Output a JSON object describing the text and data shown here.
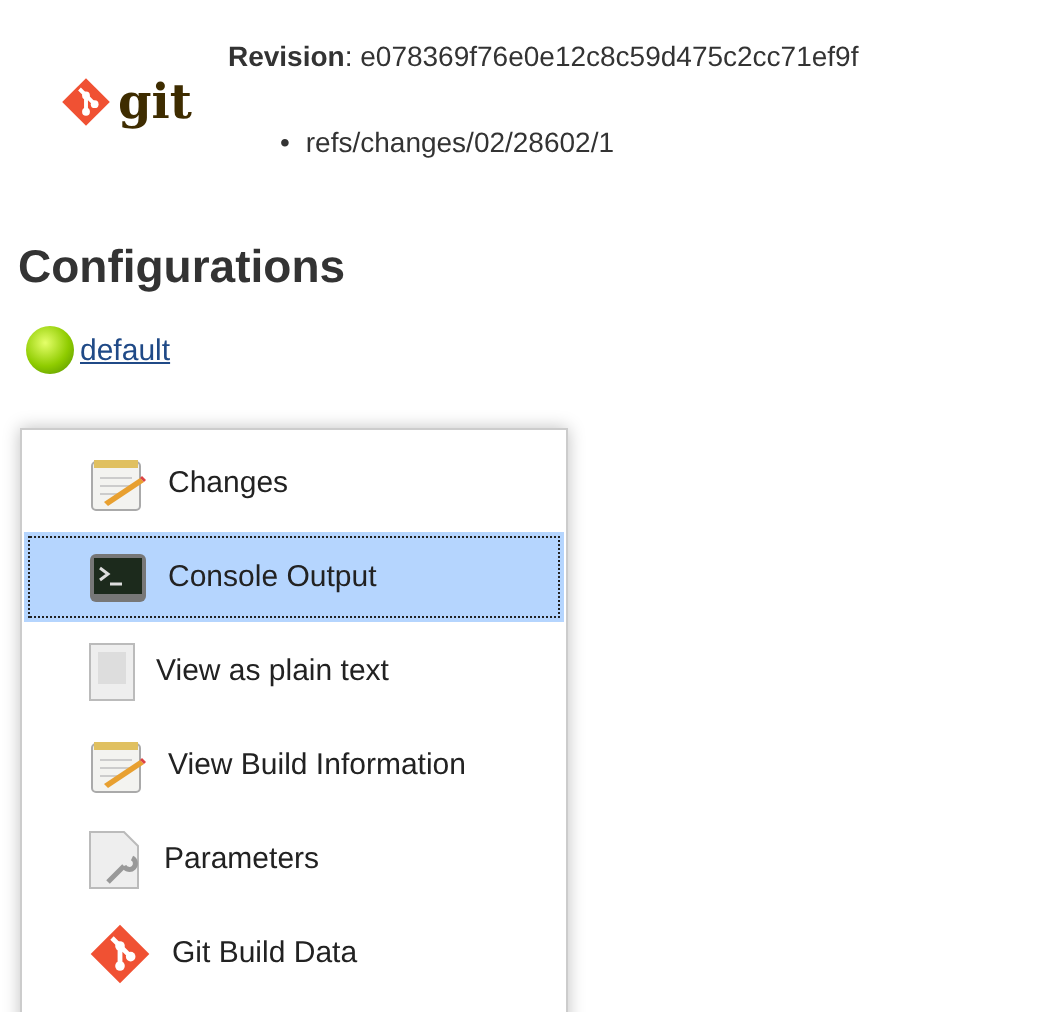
{
  "scm": {
    "logo": "git",
    "revision": "**Revision**: e078369f76e0e12c8c59d475c2cc71ef9f",
    "refs": [
      {
        "marker": "•",
        "text": "refs/changes/02/28602/1"
      }
    ]
  },
  "heading": "Configurations",
  "configuration": {
    "name": "default"
  },
  "menu": [
    {
      "label": "Changes",
      "kind": "notepad",
      "selected": false
    },
    {
      "label": "Console Output",
      "kind": "terminal",
      "selected": true
    },
    {
      "label": "View as plain text",
      "kind": "document",
      "selected": false
    },
    {
      "label": "View Build Information",
      "kind": "notepad",
      "selected": false
    },
    {
      "label": "Parameters",
      "kind": "wrench",
      "selected": false
    },
    {
      "label": "Git Build Data",
      "kind": "git",
      "selected": false
    }
  ]
}
